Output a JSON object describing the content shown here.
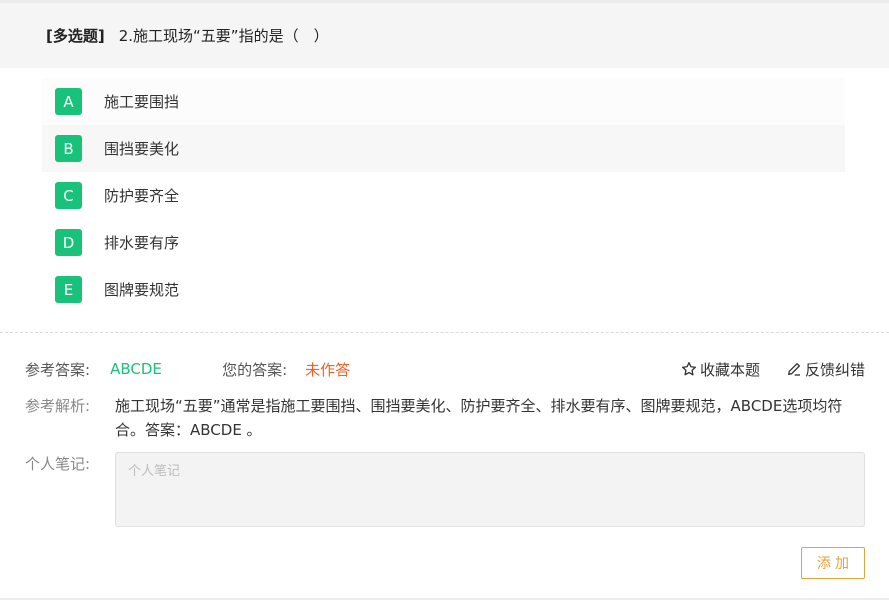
{
  "question": {
    "type_label": "[多选题]",
    "title": "2.施工现场“五要”指的是（　）"
  },
  "options": [
    {
      "letter": "A",
      "text": "施工要围挡"
    },
    {
      "letter": "B",
      "text": "围挡要美化"
    },
    {
      "letter": "C",
      "text": "防护要齐全"
    },
    {
      "letter": "D",
      "text": "排水要有序"
    },
    {
      "letter": "E",
      "text": "图牌要规范"
    }
  ],
  "answer": {
    "ref_label": "参考答案:",
    "ref_value": "ABCDE",
    "your_label": "您的答案:",
    "your_value": "未作答"
  },
  "actions": {
    "favorite_label": "收藏本题",
    "feedback_label": "反馈纠错"
  },
  "analysis": {
    "label": "参考解析:",
    "text": "施工现场“五要”通常是指施工要围挡、围挡要美化、防护要齐全、排水要有序、图牌要规范，ABCDE选项均符合。答案：ABCDE 。"
  },
  "notes": {
    "label": "个人笔记:",
    "placeholder": "个人笔记",
    "value": ""
  },
  "add_button_label": "添加",
  "colors": {
    "option_badge": "#19c27a",
    "ref_answer": "#19c27a",
    "your_answer": "#f06026",
    "add_button": "#e6a33a"
  },
  "icons": {
    "favorite": "star-outline-icon",
    "feedback": "pencil-icon"
  }
}
